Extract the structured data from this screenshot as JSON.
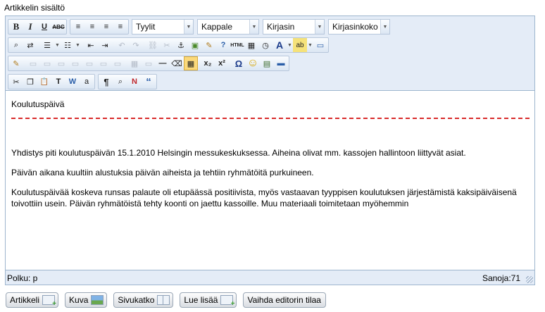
{
  "page": {
    "section_label": "Artikkelin sisältö"
  },
  "toolbar": {
    "row1": {
      "bold": "B",
      "italic": "I",
      "underline": "U",
      "strike": "ABC",
      "align_left": "≡",
      "align_center": "≡",
      "align_right": "≡",
      "align_justify": "≡",
      "selects": {
        "styles": "Tyylit",
        "format": "Kappale",
        "font": "Kirjasin",
        "size": "Kirjasinkoko"
      }
    },
    "row2": {
      "find": "⌕",
      "replace": "⇄",
      "bullets": "☰",
      "numbers": "☷",
      "outdent": "⇤",
      "indent": "⇥",
      "undo": "↶",
      "redo": "↷",
      "link": "⛓",
      "unlink": "✂",
      "anchor": "⚓",
      "image": "▣",
      "cleanup": "✎",
      "help": "?",
      "html": "HTML",
      "date": "▦",
      "time": "◷",
      "forecolor": "A",
      "backcolor": "ab",
      "fullscreen": "▭"
    },
    "row3": {
      "edit": "✎",
      "b1": "▭",
      "b2": "▭",
      "b3": "▭",
      "b4": "▭",
      "b5": "▭",
      "b6": "▭",
      "b7": "▭",
      "table": "▦",
      "b8": "▭",
      "hr": "—",
      "eraser": "⌫",
      "grid": "▦",
      "subscript": "x₂",
      "superscript": "x²",
      "charmap": "Ω",
      "emotion": "☺",
      "media": "▤",
      "ruler": "▬"
    },
    "row4": {
      "cut": "✂",
      "copy": "❐",
      "paste": "📋",
      "paste_text": "T",
      "paste_word": "W",
      "select_all": "a",
      "pilcrow": "¶",
      "preview": "⌕",
      "nonbreak": "N",
      "quote": "“"
    }
  },
  "content": {
    "title": "Koulutuspäivä",
    "paragraphs": [
      "Yhdistys piti koulutuspäivän 15.1.2010 Helsingin messukeskuksessa. Aiheina olivat mm. kassojen hallintoon liittyvät asiat.",
      "Päivän aikana kuultiin alustuksia päivän aiheista ja tehtiin ryhmätöitä purkuineen.",
      "Koulutuspäivää koskeva runsas palaute oli etupäässä positiivista, myös vastaavan tyyppisen koulutuksen järjestämistä kaksipäiväisenä toivottiin usein. Päivän ryhmätöistä tehty koonti on jaettu kassoille. Muu materiaali toimitetaan myöhemmin"
    ]
  },
  "statusbar": {
    "path": "Polku: p",
    "word_count": "Sanoja:71"
  },
  "buttons": {
    "article": "Artikkeli",
    "image": "Kuva",
    "page_break": "Sivukatko",
    "read_more": "Lue lisää",
    "toggle_editor": "Vaihda editorin tilaa"
  },
  "colors": {
    "toolbar_bg": "#e4ecf7",
    "border": "#9eb6ce",
    "page_break_line": "#d92b2b"
  }
}
